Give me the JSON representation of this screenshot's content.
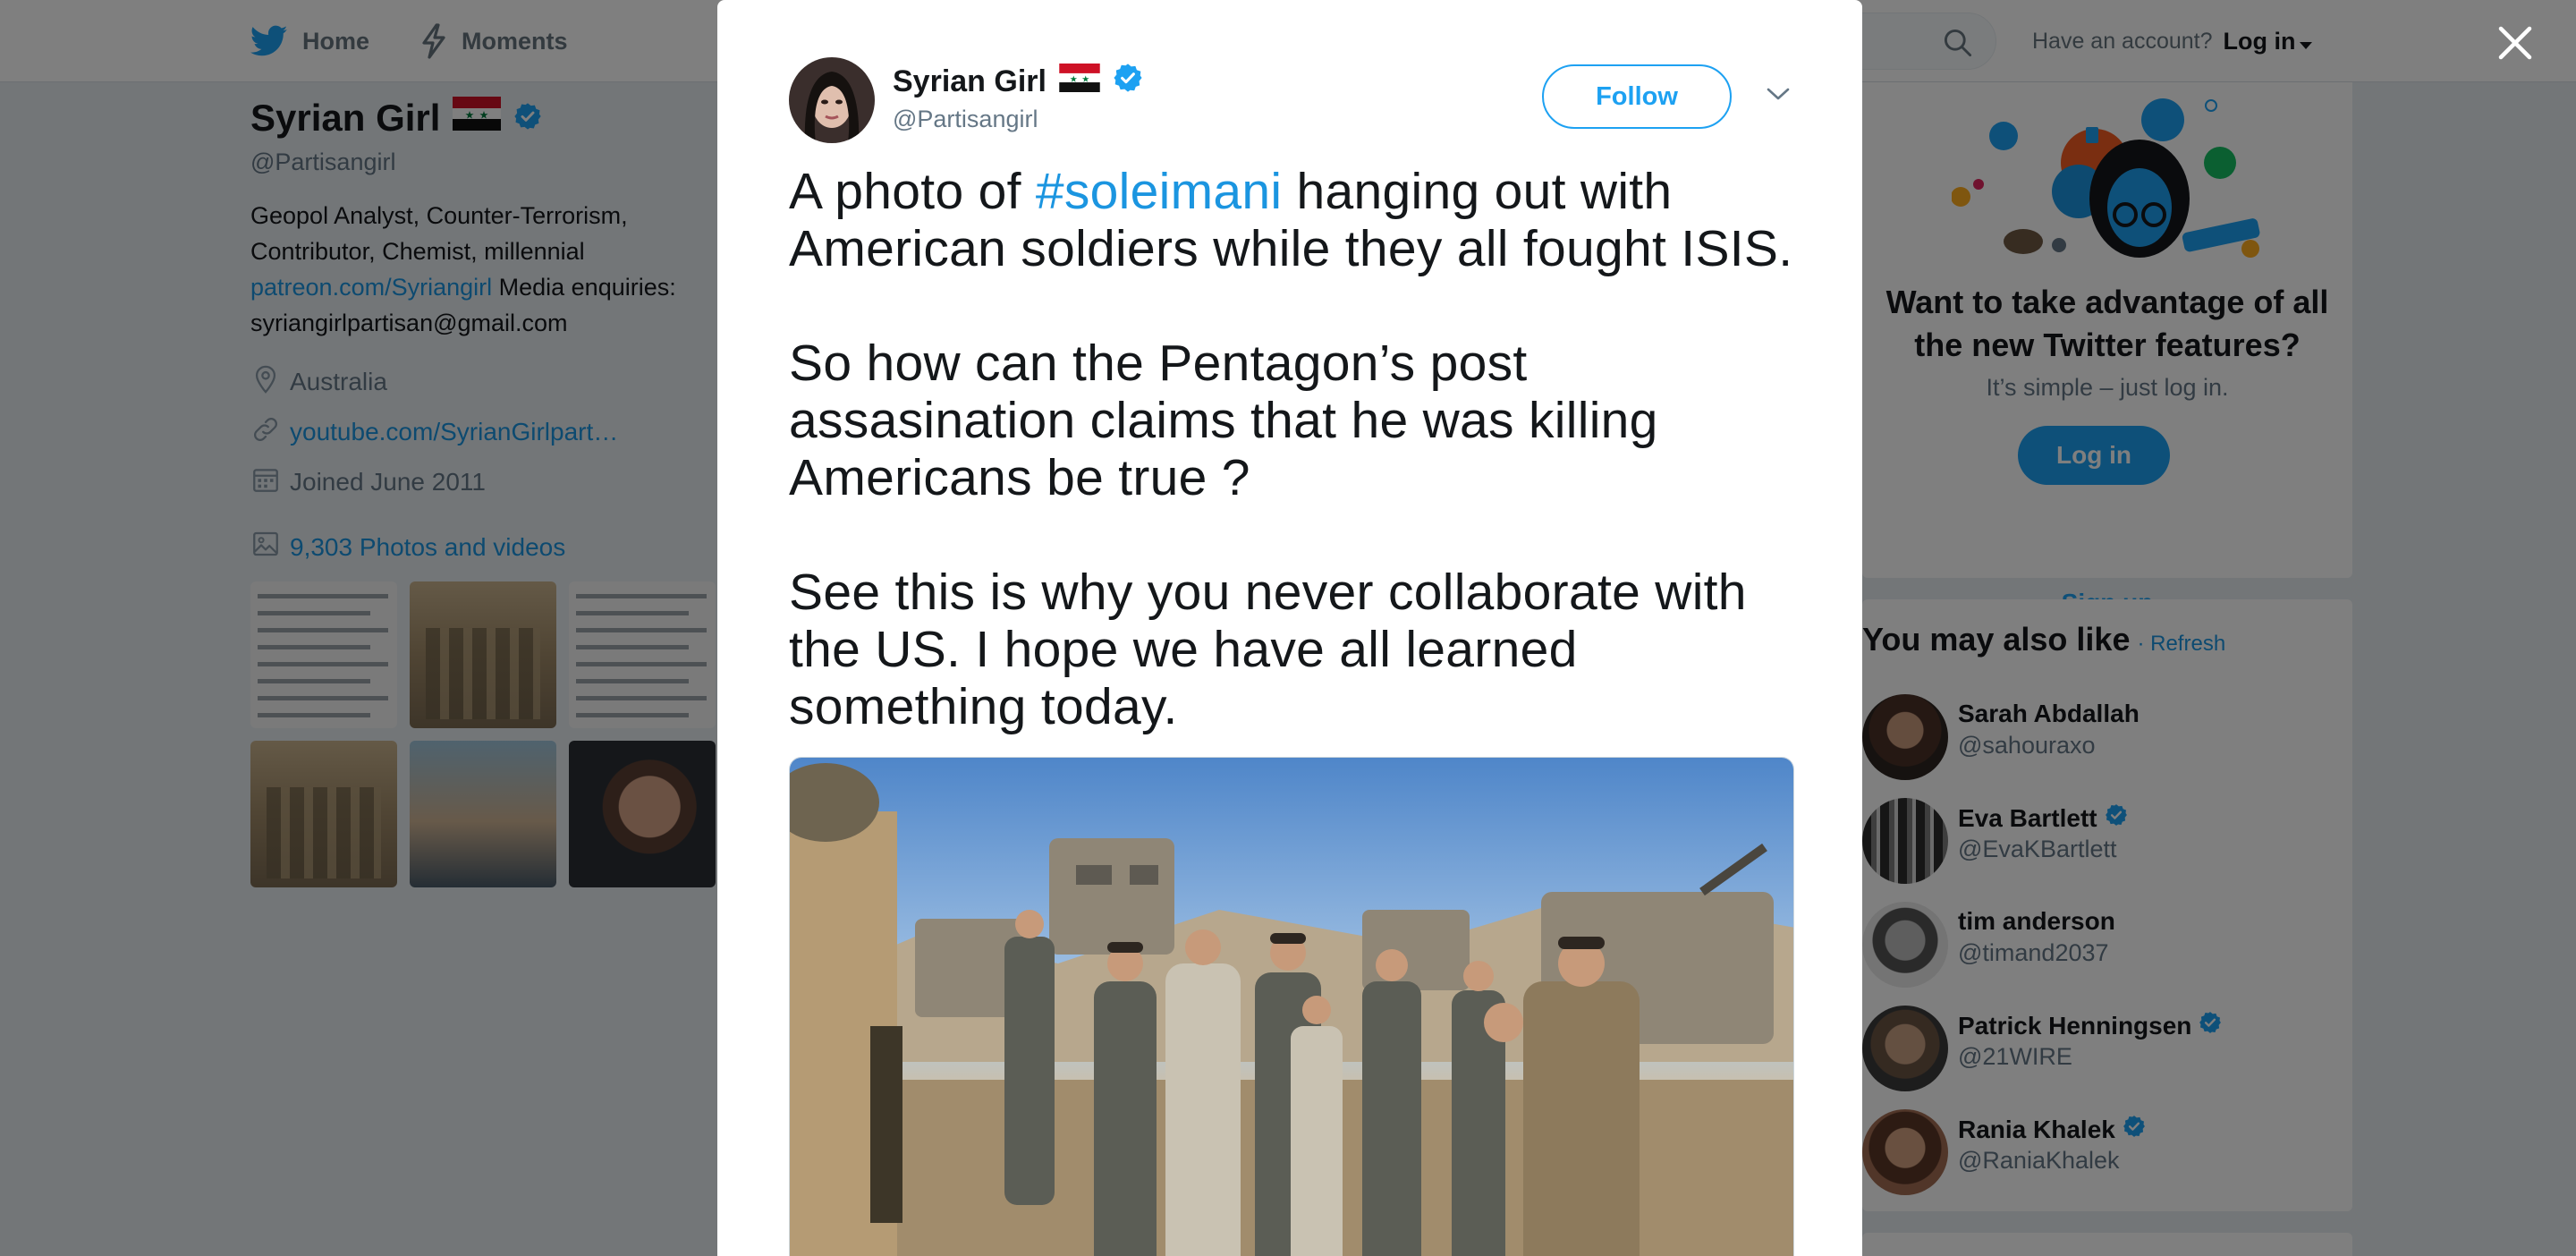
{
  "topnav": {
    "home_label": "Home",
    "moments_label": "Moments",
    "account_prompt": "Have an account?",
    "login_label": "Log in"
  },
  "profile": {
    "name": "Syrian Girl",
    "handle": "@Partisangirl",
    "bio_text": "Geopol Analyst, Counter-Terrorism, Contributor, Chemist, millennial",
    "bio_link": "patreon.com/Syriangirl",
    "bio_after_link": " Media enquiries: syriangirlpartisan@gmail.com",
    "location": "Australia",
    "website": "youtube.com/SyrianGirlpart…",
    "joined": "Joined June 2011",
    "photos_label": "9,303 Photos and videos"
  },
  "signup_card": {
    "title": "Want to take advantage of all the new Twitter features?",
    "subtitle": "It’s simple – just log in.",
    "login_button": "Log in",
    "signup_link": "Sign up"
  },
  "who_to_follow": {
    "heading": "You may also like",
    "refresh": "· Refresh",
    "users": [
      {
        "name": "Sarah Abdallah",
        "handle": "@sahouraxo",
        "verified": false
      },
      {
        "name": "Eva Bartlett",
        "handle": "@EvaKBartlett",
        "verified": true
      },
      {
        "name": "tim anderson",
        "handle": "@timand2037",
        "verified": false
      },
      {
        "name": "Patrick Henningsen",
        "handle": "@21WIRE",
        "verified": true
      },
      {
        "name": "Rania Khalek",
        "handle": "@RaniaKhalek",
        "verified": true
      }
    ]
  },
  "tweet": {
    "author_name": "Syrian Girl",
    "author_handle": "@Partisangirl",
    "follow_label": "Follow",
    "text_before_hashtag": "A photo of ",
    "hashtag": "#soleimani",
    "text_after_hashtag": " hanging out with American soldiers while they all fought ISIS.",
    "paragraph_2": "So how can the Pentagon’s post assasination claims that he was killing Americans be true ?",
    "paragraph_3": "See this is why you never collaborate with the US. I hope we have all learned something today."
  },
  "colors": {
    "twitter_blue": "#1da1f2",
    "link_blue": "#1b95e0",
    "verified_blue": "#1da1f2",
    "text_dark": "#14171a",
    "text_muted": "#657786"
  },
  "icons": {
    "home": "twitter-bird-icon",
    "moments": "lightning-icon",
    "search": "search-icon",
    "close": "close-icon",
    "location": "location-pin-icon",
    "link": "link-icon",
    "calendar": "calendar-icon",
    "photos": "image-icon",
    "verified": "verified-badge-icon",
    "flag": "syria-flag-icon",
    "more": "chevron-down-icon"
  }
}
